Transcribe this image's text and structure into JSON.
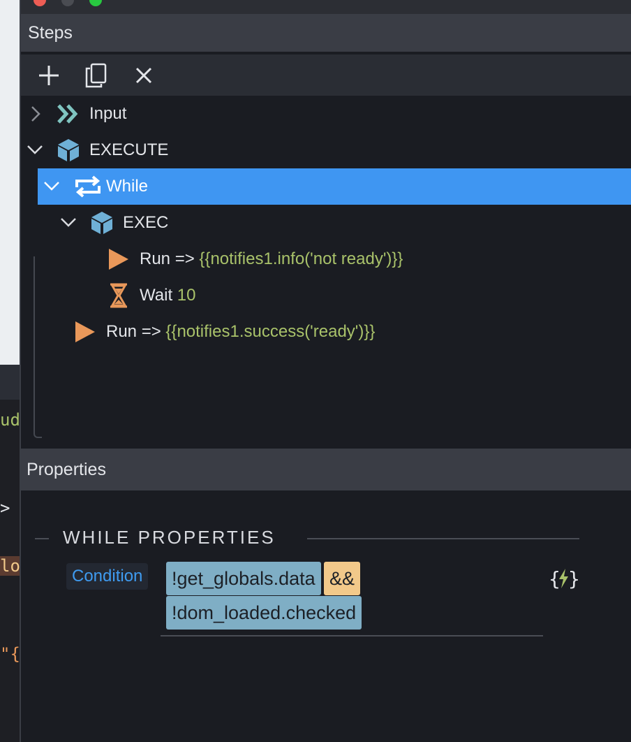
{
  "window": {
    "traffic_lights": [
      "#ee5d55",
      "#4a4c52",
      "#28c840"
    ]
  },
  "editor_fragments": [
    "ud",
    ">",
    "lo",
    "\"{"
  ],
  "steps_panel": {
    "title": "Steps",
    "toolbar": {
      "add_icon": "plus-icon",
      "copy_icon": "copy-icon",
      "delete_icon": "close-icon"
    },
    "tree": [
      {
        "label": "Input",
        "icon": "chevrons-right-icon",
        "expanded": false
      },
      {
        "label": "EXECUTE",
        "icon": "cube-icon",
        "expanded": true
      },
      {
        "label": "While",
        "icon": "loop-icon",
        "expanded": true,
        "selected": true
      },
      {
        "label": "EXEC",
        "icon": "cube-icon",
        "expanded": true
      },
      {
        "label": "Run =>",
        "value": "{{notifies1.info('not ready')}}",
        "icon": "play-icon"
      },
      {
        "label": "Wait",
        "value": "10",
        "icon": "hourglass-icon"
      },
      {
        "label": "Run =>",
        "value": "{{notifies1.success('ready')}}",
        "icon": "play-icon"
      }
    ]
  },
  "properties_panel": {
    "title": "Properties",
    "section_title": "WHILE PROPERTIES",
    "condition_label": "Condition",
    "condition_tokens": [
      "!get_globals.data",
      "&&",
      "!dom_loaded.checked"
    ],
    "expression_button_icon": "curly-bolt-icon"
  },
  "colors": {
    "selected_row": "#3f96f2",
    "accent_green": "#a9c26a",
    "icon_teal": "#7fc4c0",
    "icon_cube": "#6fb0d6",
    "icon_orange": "#e9985a",
    "token_var": "#7faec5",
    "token_op": "#f2c98a"
  }
}
